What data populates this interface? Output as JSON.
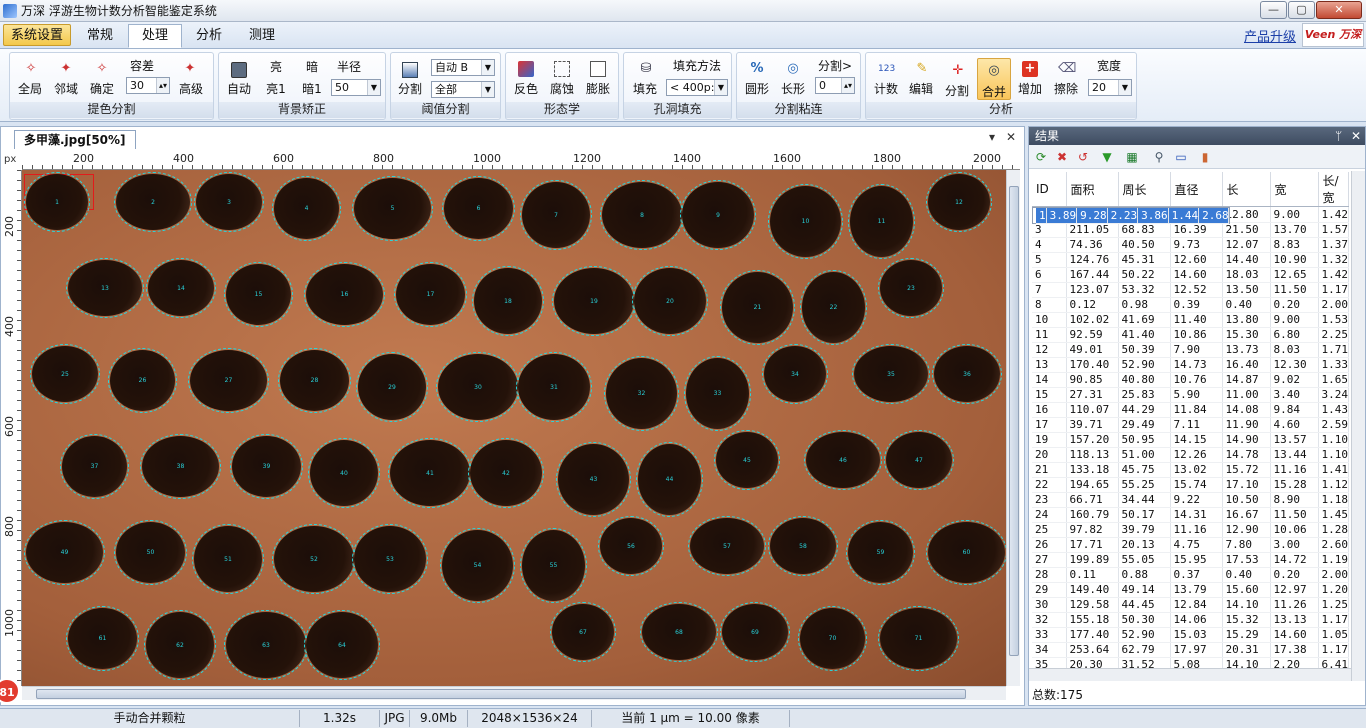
{
  "window": {
    "title": "万深 浮游生物计数分析智能鉴定系统",
    "min": "—",
    "max": "▢",
    "close": "✕"
  },
  "menu": {
    "tabs": [
      "系统设置",
      "常规",
      "处理",
      "分析",
      "测理"
    ],
    "upgrade": "产品升级",
    "logo": "Veen 万深"
  },
  "ribbon": {
    "g1": {
      "label": "提色分割",
      "items": [
        "全局",
        "邻域",
        "确定",
        "高级"
      ],
      "tol_label": "容差",
      "tol_value": "30"
    },
    "g2": {
      "label": "背景矫正",
      "items": [
        "自动",
        "亮1",
        "暗1"
      ],
      "bright": "亮",
      "dark": "暗",
      "radius_label": "半径",
      "radius_value": "50"
    },
    "g3": {
      "label": "阈值分割",
      "item": "分割",
      "auto_value": "自动 B",
      "all_value": "全部"
    },
    "g4": {
      "label": "形态学",
      "items": [
        "反色",
        "腐蚀",
        "膨胀"
      ]
    },
    "g5": {
      "label": "孔洞填充",
      "item": "填充",
      "method_label": "填充方法",
      "method_value": "< 400p:"
    },
    "g6": {
      "label": "分割粘连",
      "items": [
        "圆形",
        "长形"
      ],
      "split_label": "分割>",
      "split_value": "0"
    },
    "g7": {
      "label": "分析",
      "items": [
        "计数",
        "编辑",
        "分割",
        "合并",
        "增加",
        "擦除"
      ],
      "width_label": "宽度",
      "width_value": "20"
    }
  },
  "doc": {
    "tab": "多甲藻.jpg[50%]",
    "ruler_unit": "px",
    "hticks": [
      "200",
      "400",
      "600",
      "800",
      "1000",
      "1200",
      "1400",
      "1600",
      "1800",
      "2000"
    ],
    "vticks": [
      "200",
      "400",
      "600",
      "800",
      "1000"
    ],
    "badge": "81",
    "pane_menu": "▾",
    "pane_close": "✕"
  },
  "particles": [
    {
      "n": "1"
    },
    {
      "n": "2"
    },
    {
      "n": "3"
    },
    {
      "n": "4"
    },
    {
      "n": "5"
    },
    {
      "n": "6"
    },
    {
      "n": "7"
    },
    {
      "n": "8"
    },
    {
      "n": "9"
    },
    {
      "n": "10"
    },
    {
      "n": "11"
    },
    {
      "n": "12"
    },
    {
      "n": "13"
    },
    {
      "n": "14"
    },
    {
      "n": "15"
    },
    {
      "n": "16"
    },
    {
      "n": "17"
    },
    {
      "n": "18"
    },
    {
      "n": "19"
    },
    {
      "n": "20"
    },
    {
      "n": "21"
    },
    {
      "n": "22"
    },
    {
      "n": "23"
    },
    {
      "n": "24"
    },
    {
      "n": "25"
    },
    {
      "n": "26"
    },
    {
      "n": "27"
    },
    {
      "n": "28"
    },
    {
      "n": "29"
    },
    {
      "n": "30"
    },
    {
      "n": "31"
    },
    {
      "n": "32"
    },
    {
      "n": "33"
    },
    {
      "n": "34"
    },
    {
      "n": "35"
    },
    {
      "n": "36"
    },
    {
      "n": "37"
    },
    {
      "n": "38"
    },
    {
      "n": "39"
    },
    {
      "n": "40"
    },
    {
      "n": "41"
    },
    {
      "n": "42"
    },
    {
      "n": "43"
    },
    {
      "n": "44"
    },
    {
      "n": "45"
    },
    {
      "n": "46"
    },
    {
      "n": "47"
    },
    {
      "n": "48"
    },
    {
      "n": "49"
    },
    {
      "n": "50"
    },
    {
      "n": "51"
    },
    {
      "n": "52"
    },
    {
      "n": "53"
    },
    {
      "n": "54"
    },
    {
      "n": "55"
    },
    {
      "n": "56"
    },
    {
      "n": "57"
    },
    {
      "n": "58"
    },
    {
      "n": "59"
    },
    {
      "n": "60"
    },
    {
      "n": "61"
    },
    {
      "n": "62"
    },
    {
      "n": "63"
    },
    {
      "n": "64"
    },
    {
      "n": "65"
    },
    {
      "n": "66"
    },
    {
      "n": "67"
    },
    {
      "n": "68"
    },
    {
      "n": "69"
    },
    {
      "n": "70"
    },
    {
      "n": "71"
    },
    {
      "n": "72"
    }
  ],
  "results": {
    "title": "结果",
    "pin": "ᛘ",
    "close": "✕",
    "columns": [
      "ID",
      "面积",
      "周长",
      "直径",
      "长",
      "宽",
      "长/宽"
    ],
    "rows": [
      [
        "1",
        "3.89",
        "9.28",
        "2.23",
        "3.86",
        "1.44",
        "2.68"
      ],
      [
        "2",
        "94.88",
        "39.37",
        "10.99",
        "12.80",
        "9.00",
        "1.42"
      ],
      [
        "3",
        "211.05",
        "68.83",
        "16.39",
        "21.50",
        "13.70",
        "1.57"
      ],
      [
        "4",
        "74.36",
        "40.50",
        "9.73",
        "12.07",
        "8.83",
        "1.37"
      ],
      [
        "5",
        "124.76",
        "45.31",
        "12.60",
        "14.40",
        "10.90",
        "1.32"
      ],
      [
        "6",
        "167.44",
        "50.22",
        "14.60",
        "18.03",
        "12.65",
        "1.42"
      ],
      [
        "7",
        "123.07",
        "53.32",
        "12.52",
        "13.50",
        "11.50",
        "1.17"
      ],
      [
        "8",
        "0.12",
        "0.98",
        "0.39",
        "0.40",
        "0.20",
        "2.00"
      ],
      [
        "10",
        "102.02",
        "41.69",
        "11.40",
        "13.80",
        "9.00",
        "1.53"
      ],
      [
        "11",
        "92.59",
        "41.40",
        "10.86",
        "15.30",
        "6.80",
        "2.25"
      ],
      [
        "12",
        "49.01",
        "50.39",
        "7.90",
        "13.73",
        "8.03",
        "1.71"
      ],
      [
        "13",
        "170.40",
        "52.90",
        "14.73",
        "16.40",
        "12.30",
        "1.33"
      ],
      [
        "14",
        "90.85",
        "40.80",
        "10.76",
        "14.87",
        "9.02",
        "1.65"
      ],
      [
        "15",
        "27.31",
        "25.83",
        "5.90",
        "11.00",
        "3.40",
        "3.24"
      ],
      [
        "16",
        "110.07",
        "44.29",
        "11.84",
        "14.08",
        "9.84",
        "1.43"
      ],
      [
        "17",
        "39.71",
        "29.49",
        "7.11",
        "11.90",
        "4.60",
        "2.59"
      ],
      [
        "19",
        "157.20",
        "50.95",
        "14.15",
        "14.90",
        "13.57",
        "1.10"
      ],
      [
        "20",
        "118.13",
        "51.00",
        "12.26",
        "14.78",
        "13.44",
        "1.10"
      ],
      [
        "21",
        "133.18",
        "45.75",
        "13.02",
        "15.72",
        "11.16",
        "1.41"
      ],
      [
        "22",
        "194.65",
        "55.25",
        "15.74",
        "17.10",
        "15.28",
        "1.12"
      ],
      [
        "23",
        "66.71",
        "34.44",
        "9.22",
        "10.50",
        "8.90",
        "1.18"
      ],
      [
        "24",
        "160.79",
        "50.17",
        "14.31",
        "16.67",
        "11.50",
        "1.45"
      ],
      [
        "25",
        "97.82",
        "39.79",
        "11.16",
        "12.90",
        "10.06",
        "1.28"
      ],
      [
        "26",
        "17.71",
        "20.13",
        "4.75",
        "7.80",
        "3.00",
        "2.60"
      ],
      [
        "27",
        "199.89",
        "55.05",
        "15.95",
        "17.53",
        "14.72",
        "1.19"
      ],
      [
        "28",
        "0.11",
        "0.88",
        "0.37",
        "0.40",
        "0.20",
        "2.00"
      ],
      [
        "29",
        "149.40",
        "49.14",
        "13.79",
        "15.60",
        "12.97",
        "1.20"
      ],
      [
        "30",
        "129.58",
        "44.45",
        "12.84",
        "14.10",
        "11.26",
        "1.25"
      ],
      [
        "32",
        "155.18",
        "50.30",
        "14.06",
        "15.32",
        "13.13",
        "1.17"
      ],
      [
        "33",
        "177.40",
        "52.90",
        "15.03",
        "15.29",
        "14.60",
        "1.05"
      ],
      [
        "34",
        "253.64",
        "62.79",
        "17.97",
        "20.31",
        "17.38",
        "1.17"
      ],
      [
        "35",
        "20.30",
        "31.52",
        "5.08",
        "14.10",
        "2.20",
        "6.41"
      ]
    ],
    "total": "总数:175"
  },
  "status": {
    "action": "手动合并颗粒",
    "time": "1.32s",
    "format": "JPG",
    "size": "9.0Mb",
    "dims": "2048×1536×24",
    "scale": "当前 1 μm = 10.00 像素"
  }
}
